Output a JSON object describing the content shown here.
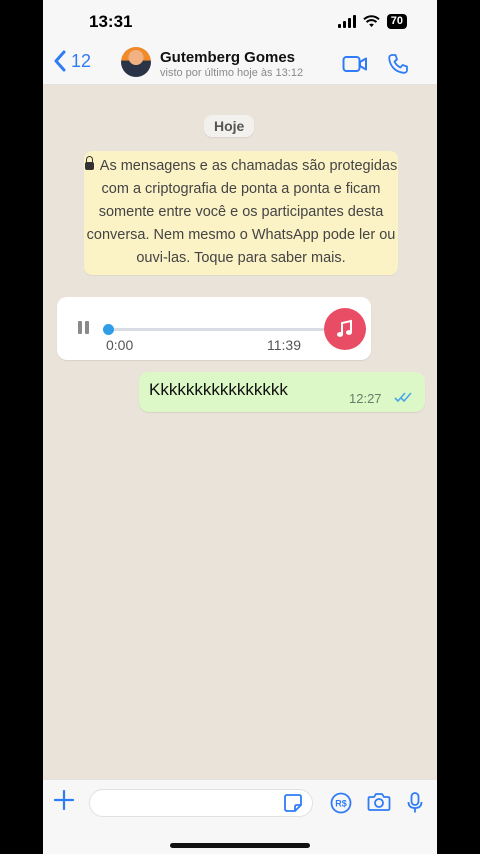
{
  "status_bar": {
    "time": "13:31",
    "battery": "70"
  },
  "header": {
    "back_count": "12",
    "contact_name": "Gutemberg Gomes",
    "contact_status": "visto por último hoje às 13:12",
    "icons": [
      "chevron-left-icon",
      "video-call-icon",
      "phone-call-icon"
    ]
  },
  "chat": {
    "date_label": "Hoje",
    "encryption_notice": "As mensagens e as chamadas são protegidas com a criptografia de ponta a ponta e ficam somente entre você e os participantes desta conversa. Nem mesmo o WhatsApp pode ler ou ouvi-las. Toque para saber mais.",
    "voice_message": {
      "elapsed": "0:00",
      "duration": "11:39",
      "progress": 0
    },
    "outgoing_message": {
      "text": "Kkkkkkkkkkkkkkkk",
      "time": "12:27",
      "status": "read"
    }
  },
  "input_bar": {
    "placeholder": "",
    "icons": [
      "plus-icon",
      "sticker-icon",
      "payment-icon",
      "camera-icon",
      "microphone-icon"
    ]
  },
  "colors": {
    "accent": "#2f7cf6",
    "outgoing_bubble": "#dcf8c6",
    "notice_bg": "#fbf2c6",
    "music_button": "#e94d66",
    "read_ticks": "#4aa6e8"
  }
}
